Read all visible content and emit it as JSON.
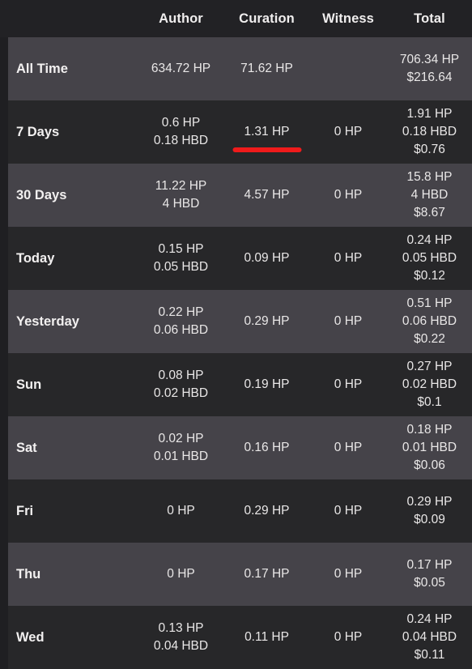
{
  "table": {
    "columns": [
      {
        "key": "label",
        "label": ""
      },
      {
        "key": "author",
        "label": "Author"
      },
      {
        "key": "curation",
        "label": "Curation"
      },
      {
        "key": "witness",
        "label": "Witness"
      },
      {
        "key": "total",
        "label": "Total"
      }
    ],
    "rows": [
      {
        "label": "All Time",
        "author": [
          "634.72 HP"
        ],
        "curation": [
          "71.62 HP"
        ],
        "witness": [],
        "total": [
          "706.34 HP",
          "$216.64"
        ]
      },
      {
        "label": "7 Days",
        "author": [
          "0.6 HP",
          "0.18 HBD"
        ],
        "curation": [
          "1.31 HP"
        ],
        "witness": [
          "0 HP"
        ],
        "total": [
          "1.91 HP",
          "0.18 HBD",
          "$0.76"
        ]
      },
      {
        "label": "30 Days",
        "author": [
          "11.22 HP",
          "4 HBD"
        ],
        "curation": [
          "4.57 HP"
        ],
        "witness": [
          "0 HP"
        ],
        "total": [
          "15.8 HP",
          "4 HBD",
          "$8.67"
        ]
      },
      {
        "label": "Today",
        "author": [
          "0.15 HP",
          "0.05 HBD"
        ],
        "curation": [
          "0.09 HP"
        ],
        "witness": [
          "0 HP"
        ],
        "total": [
          "0.24 HP",
          "0.05 HBD",
          "$0.12"
        ]
      },
      {
        "label": "Yesterday",
        "author": [
          "0.22 HP",
          "0.06 HBD"
        ],
        "curation": [
          "0.29 HP"
        ],
        "witness": [
          "0 HP"
        ],
        "total": [
          "0.51 HP",
          "0.06 HBD",
          "$0.22"
        ]
      },
      {
        "label": "Sun",
        "author": [
          "0.08 HP",
          "0.02 HBD"
        ],
        "curation": [
          "0.19 HP"
        ],
        "witness": [
          "0 HP"
        ],
        "total": [
          "0.27 HP",
          "0.02 HBD",
          "$0.1"
        ]
      },
      {
        "label": "Sat",
        "author": [
          "0.02 HP",
          "0.01 HBD"
        ],
        "curation": [
          "0.16 HP"
        ],
        "witness": [
          "0 HP"
        ],
        "total": [
          "0.18 HP",
          "0.01 HBD",
          "$0.06"
        ]
      },
      {
        "label": "Fri",
        "author": [
          "0 HP"
        ],
        "curation": [
          "0.29 HP"
        ],
        "witness": [
          "0 HP"
        ],
        "total": [
          "0.29 HP",
          "$0.09"
        ]
      },
      {
        "label": "Thu",
        "author": [
          "0 HP"
        ],
        "curation": [
          "0.17 HP"
        ],
        "witness": [
          "0 HP"
        ],
        "total": [
          "0.17 HP",
          "$0.05"
        ]
      },
      {
        "label": "Wed",
        "author": [
          "0.13 HP",
          "0.04 HBD"
        ],
        "curation": [
          "0.11 HP"
        ],
        "witness": [
          "0 HP"
        ],
        "total": [
          "0.24 HP",
          "0.04 HBD",
          "$0.11"
        ]
      }
    ]
  },
  "annotation": {
    "type": "underline",
    "color": "#ef1b1b",
    "target_row": "7 Days",
    "target_column": "curation",
    "target_text": "1.31 HP"
  },
  "theme": {
    "page_bg": "#1f1f22",
    "row_bg": "#272729",
    "row_bg_alt": "#454349",
    "header_bg": "#222225",
    "text_color": "#e9e7e7",
    "label_color": "#f2f0f0"
  }
}
